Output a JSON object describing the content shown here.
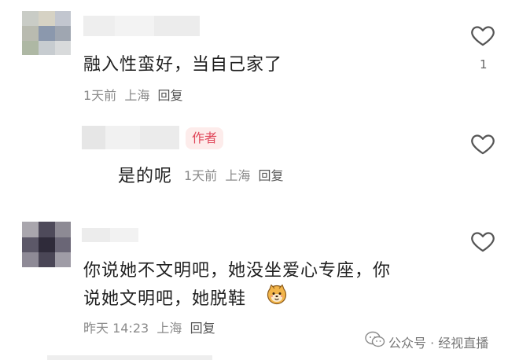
{
  "comments": [
    {
      "text": "融入性蛮好，当自己家了",
      "time": "1天前",
      "location": "上海",
      "reply_label": "回复",
      "like_count": "1"
    },
    {
      "text": "是的呢",
      "time": "1天前",
      "location": "上海",
      "reply_label": "回复",
      "author_badge": "作者"
    },
    {
      "text_line1": "你说她不文明吧，她没坐爱心专座，你",
      "text_line2": "说她文明吧，她脱鞋",
      "emoji": "shiba-dog-face-icon",
      "time": "昨天 14:23",
      "location": "上海",
      "reply_label": "回复"
    }
  ],
  "watermark": {
    "source_label": "公众号 · 经视直播"
  },
  "colors": {
    "author_badge_bg": "#fdeceb",
    "author_badge_text": "#e0475a",
    "meta_text": "#8a8a8a"
  }
}
